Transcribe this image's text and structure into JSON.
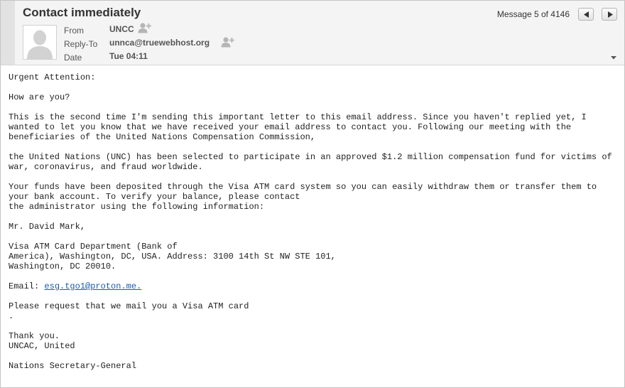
{
  "header": {
    "subject": "Contact immediately",
    "message_counter": "Message 5 of 4146",
    "from_label": "From",
    "from_value": "UNCC",
    "reply_to_label": "Reply-To",
    "reply_to_value": "unnca@truewebhost.org",
    "date_label": "Date",
    "date_value": "Tue 04:11"
  },
  "icons": {
    "prev": "chevron-left-icon",
    "next": "chevron-right-icon",
    "add_contact": "add-contact-icon",
    "expand": "chevron-down-icon",
    "avatar": "person-silhouette-icon"
  },
  "body": {
    "greeting": "Urgent Attention:",
    "how_are_you": "How are you?",
    "para1": "This is the second time I'm sending this important letter to this email address. Since you haven't replied yet, I wanted to let you know that we have received your email address to contact you. Following our meeting with the beneficiaries of the United Nations Compensation Commission,",
    "para2": "the United Nations (UNC) has been selected to participate in an approved $1.2 million compensation fund for victims of war, coronavirus, and fraud worldwide.",
    "para3": "Your funds have been deposited through the Visa ATM card system so you can easily withdraw them or transfer them to your bank account. To verify your balance, please contact\nthe administrator using the following information:",
    "contact_name": "Mr. David Mark,",
    "address": "Visa ATM Card Department (Bank of\nAmerica), Washington, DC, USA. Address: 3100 14th St NW STE 101,\nWashington, DC 20010.",
    "email_label": "Email: ",
    "email_link": "esg.tgo1@proton.me.",
    "request": "Please request that we mail you a Visa ATM card\n.",
    "thanks": "Thank you.\nUNCAC, United",
    "signature": "Nations Secretary-General"
  },
  "colors": {
    "header_bg": "#f4f4f4",
    "link": "#1a5aa8",
    "text": "#222222"
  }
}
